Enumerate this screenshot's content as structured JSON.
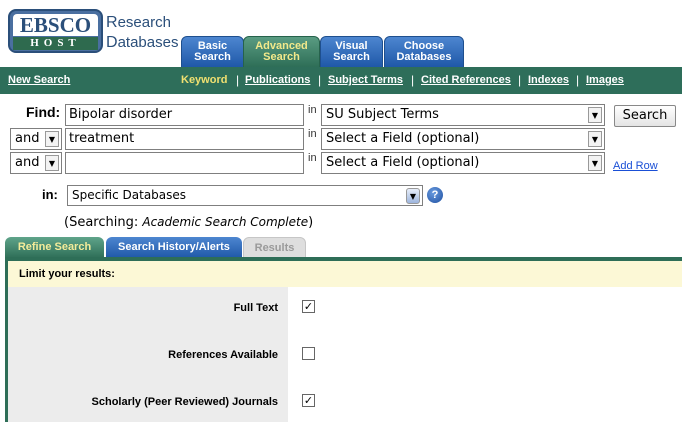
{
  "logo": {
    "top": "EBSCO",
    "bottom": "HOST"
  },
  "brand": {
    "line1_initial": "R",
    "line1_rest": "esearch",
    "line2_initial": "D",
    "line2_rest": "atabases"
  },
  "top_tabs": [
    {
      "line1": "Basic",
      "line2": "Search"
    },
    {
      "line1": "Advanced",
      "line2": "Search"
    },
    {
      "line1": "Visual",
      "line2": "Search"
    },
    {
      "line1": "Choose",
      "line2": "Databases"
    }
  ],
  "subnav": {
    "new_search": "New Search",
    "links": [
      "Keyword",
      "Publications",
      "Subject Terms",
      "Cited References",
      "Indexes",
      "Images"
    ],
    "sep": "|"
  },
  "find": {
    "label": "Find:",
    "in_word": "in",
    "rows": [
      {
        "text": "Bipolar disorder",
        "field": "SU Subject Terms"
      },
      {
        "op": "and",
        "text": "treatment",
        "field": "Select a Field (optional)"
      },
      {
        "op": "and",
        "text": "",
        "field": "Select a Field (optional)"
      }
    ],
    "search_button": "Search",
    "add_row": "Add Row"
  },
  "databases": {
    "label": "in:",
    "value": "Specific Databases",
    "searching_prefix": "(Searching: ",
    "searching_db": "Academic Search Complete",
    "searching_suffix": ")"
  },
  "lower_tabs": [
    "Refine Search",
    "Search History/Alerts",
    "Results"
  ],
  "limits": {
    "header": "Limit your results:",
    "items": [
      {
        "label": "Full Text",
        "checked": true
      },
      {
        "label": "References Available",
        "checked": false
      },
      {
        "label": "Scholarly (Peer Reviewed) Journals",
        "checked": true
      }
    ]
  },
  "colors": {
    "nav_green": "#2e6e5a",
    "tab_blue": "#1f58a8",
    "link_blue": "#1a4fd6",
    "limit_bg": "#fcf8d6"
  },
  "icons": {
    "help": "help-icon",
    "dropdown": "chevron-down-icon"
  }
}
